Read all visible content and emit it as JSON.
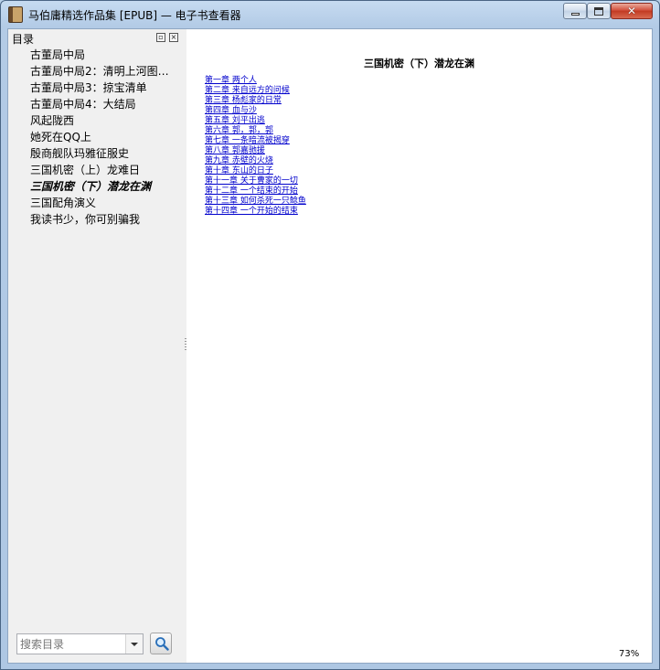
{
  "window": {
    "title": "马伯庸精选作品集 [EPUB] — 电子书查看器"
  },
  "sidebar": {
    "header": "目录",
    "items": [
      {
        "label": "古董局中局"
      },
      {
        "label": "古董局中局2：清明上河图…"
      },
      {
        "label": "古董局中局3：掠宝清单"
      },
      {
        "label": "古董局中局4：大结局"
      },
      {
        "label": "风起陇西"
      },
      {
        "label": "她死在QQ上"
      },
      {
        "label": "殷商舰队玛雅征服史"
      },
      {
        "label": "三国机密（上）龙难日"
      },
      {
        "label": "三国机密（下）潜龙在渊"
      },
      {
        "label": "三国配角演义"
      },
      {
        "label": "我读书少，你可别骗我"
      }
    ],
    "current_index": 8,
    "search": {
      "placeholder": "搜索目录"
    },
    "icons": {
      "float": "float-icon",
      "close": "close-icon",
      "dropdown": "chevron-down-icon",
      "search": "search-icon"
    }
  },
  "content": {
    "title": "三国机密（下）潜龙在渊",
    "chapters": [
      "第一章 两个人",
      "第二章 来自远方的问候",
      "第三章 杨彪家的日常",
      "第四章 血与沙",
      "第五章 刘平出逃",
      "第六章 郭，郭，郭",
      "第七章 一条暗流被揭穿",
      "第八章 郭嘉驰援",
      "第九章 赤壁的火烧",
      "第十章 东山的日子",
      "第十一章 关于曹家的一切",
      "第十二章 一个结束的开始",
      "第十三章 如何杀死一只鲶鱼",
      "第十四章 一个开始的结束"
    ],
    "link_color": "#0000cc"
  },
  "status": {
    "zoom": "73%"
  }
}
